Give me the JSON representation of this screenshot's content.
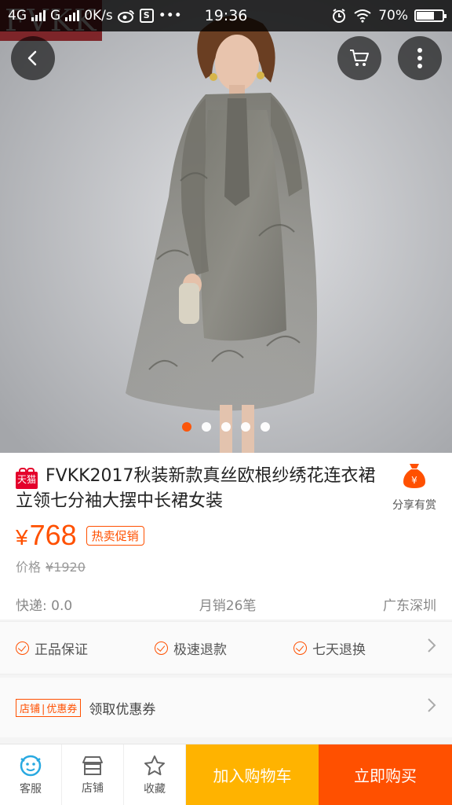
{
  "status_bar": {
    "network1": "4G",
    "network2": "G",
    "speed": "0K/s",
    "time": "19:36",
    "battery": "70%",
    "battery_level": 0.7,
    "icons": [
      "signal-icon",
      "weibo-icon",
      "s-app-icon",
      "more-dots-icon",
      "alarm-icon",
      "wifi-icon",
      "battery-icon"
    ]
  },
  "hero": {
    "watermark": "FVKK",
    "carousel_count": 5,
    "carousel_active": 0
  },
  "nav": {
    "back_icon": "chevron-left-icon",
    "cart_icon": "shopping-cart-icon",
    "more_icon": "more-vertical-icon"
  },
  "product": {
    "platform_badge": "天猫",
    "title": "FVKK2017秋装新款真丝欧根纱绣花连衣裙立领七分袖大摆中长裙女装",
    "share_label": "分享有赏",
    "currency": "¥",
    "price": "768",
    "promo_tag": "热卖促销",
    "original_price_label": "价格",
    "original_price": "¥1920",
    "shipping": "快递: 0.0",
    "monthly_sales": "月销26笔",
    "location": "广东深圳"
  },
  "guarantees": {
    "items": [
      "正品保证",
      "极速退款",
      "七天退换"
    ]
  },
  "coupon": {
    "tag_left": "店铺",
    "tag_right": "优惠券",
    "text": "领取优惠券"
  },
  "bottom_bar": {
    "service": "客服",
    "shop": "店铺",
    "favorite": "收藏",
    "add_to_cart": "加入购物车",
    "buy_now": "立即购买"
  },
  "colors": {
    "accent": "#ff5000",
    "cart_button": "#ffb300",
    "service_icon": "#29a9e1",
    "badge_red": "#e4002b"
  }
}
